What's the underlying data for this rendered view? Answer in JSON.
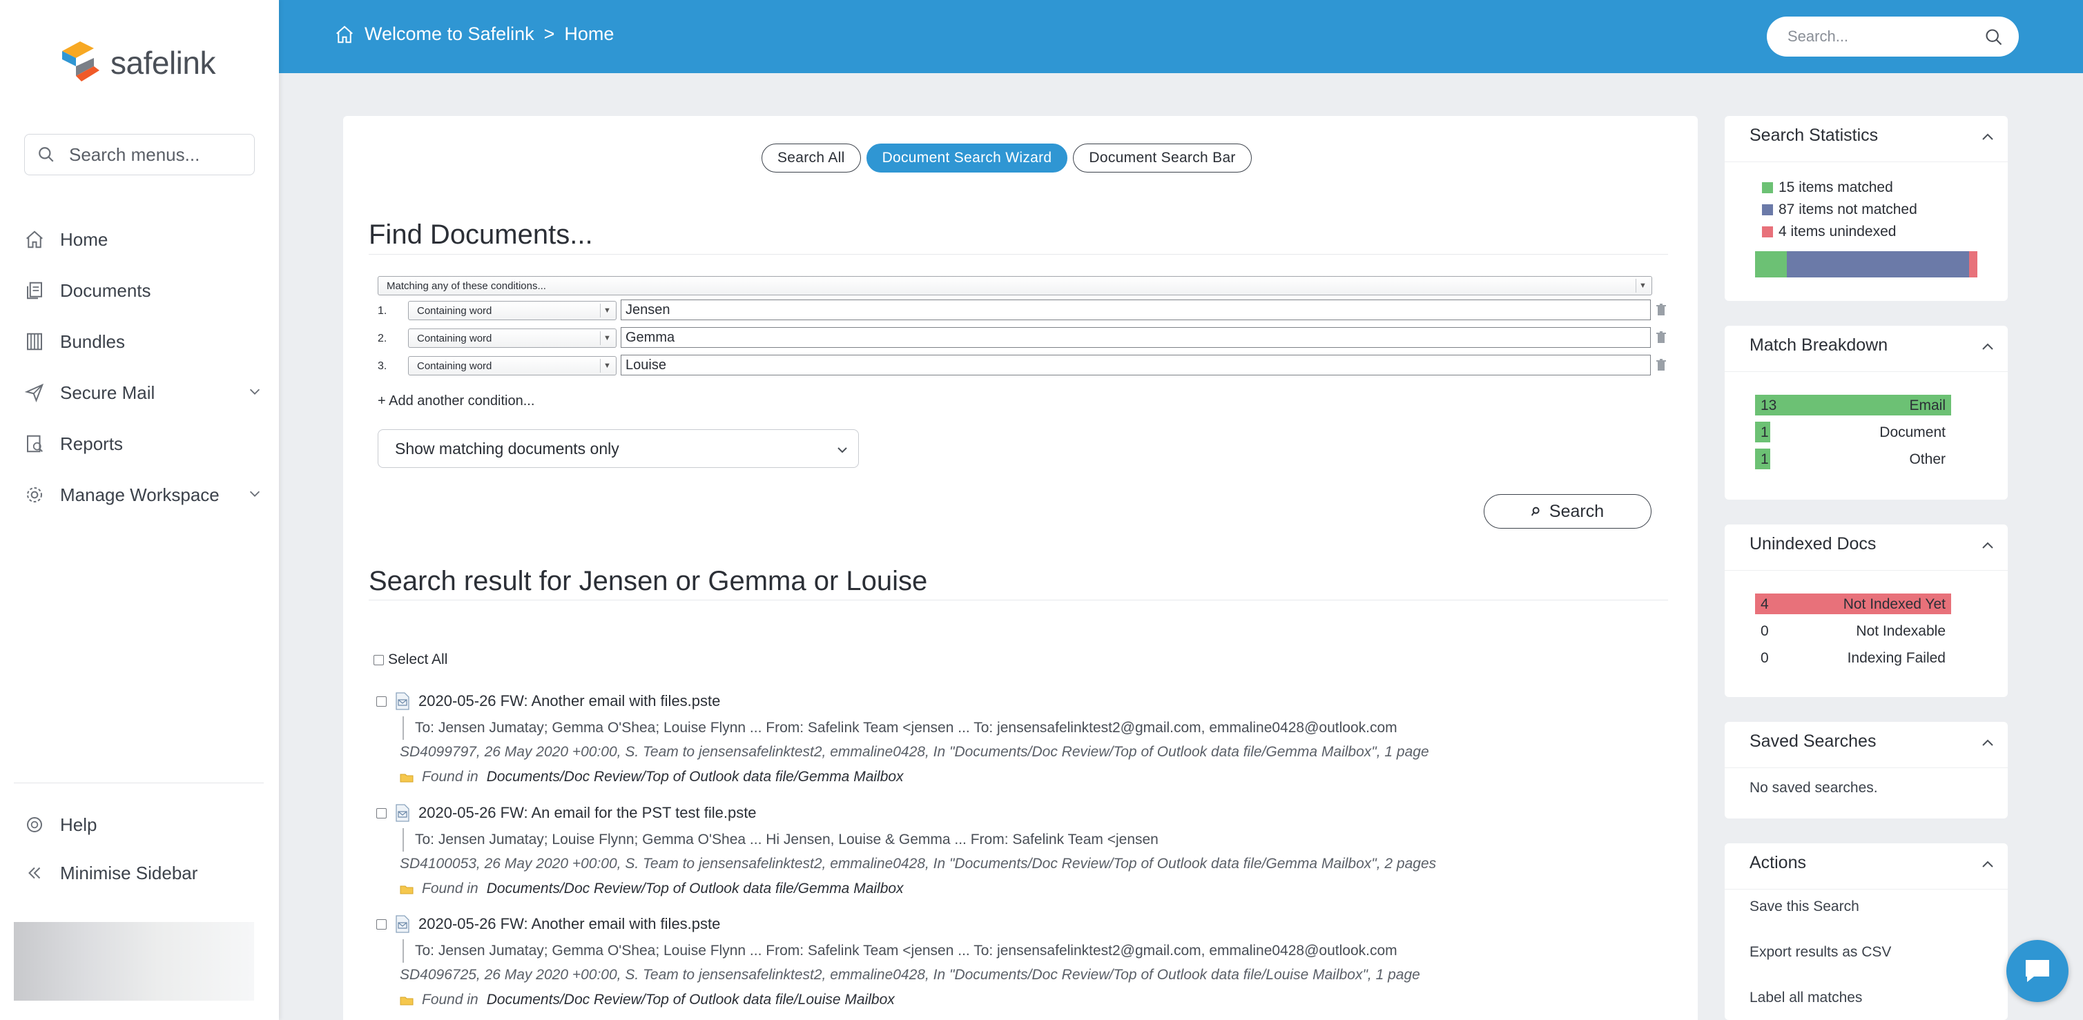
{
  "app": {
    "logo_text": "safelink"
  },
  "sidebar": {
    "search_placeholder": "Search menus...",
    "items": [
      {
        "label": "Home",
        "icon": "home-icon"
      },
      {
        "label": "Documents",
        "icon": "documents-icon"
      },
      {
        "label": "Bundles",
        "icon": "bundles-icon"
      },
      {
        "label": "Secure Mail",
        "icon": "send-icon",
        "expandable": true
      },
      {
        "label": "Reports",
        "icon": "reports-icon"
      },
      {
        "label": "Manage Workspace",
        "icon": "gear-icon",
        "expandable": true
      }
    ],
    "help_label": "Help",
    "minimise_label": "Minimise Sidebar"
  },
  "topbar": {
    "breadcrumb": [
      "Welcome to Safelink",
      ">",
      "Home"
    ],
    "search_placeholder": "Search..."
  },
  "main": {
    "modes": [
      {
        "label": "Search All",
        "active": false
      },
      {
        "label": "Document Search Wizard",
        "active": true
      },
      {
        "label": "Document Search Bar",
        "active": false
      }
    ],
    "find_title": "Find Documents...",
    "match_mode": "Matching any of these conditions...",
    "conditions": [
      {
        "num": "1.",
        "type": "Containing word",
        "value": "Jensen"
      },
      {
        "num": "2.",
        "type": "Containing word",
        "value": "Gemma"
      },
      {
        "num": "3.",
        "type": "Containing word",
        "value": "Louise"
      }
    ],
    "add_condition": "+ Add another condition...",
    "show_option": "Show matching documents only",
    "search_button": "Search",
    "result_title": "Search result for Jensen or Gemma or Louise",
    "select_all": "Select All",
    "results": [
      {
        "title": "2020-05-26 FW: Another email with files.pste",
        "snippet": "To: Jensen Jumatay; Gemma O'Shea; Louise Flynn ... From: Safelink Team <jensen ... To: jensensafelinktest2@gmail.com, emmaline0428@outlook.com",
        "meta": "SD4099797, 26 May 2020 +00:00, S. Team to jensensafelinktest2, emmaline0428, In \"Documents/Doc Review/Top of Outlook data file/Gemma Mailbox\", 1 page",
        "found_prefix": "Found in",
        "found_path": "Documents/Doc Review/Top of Outlook data file/Gemma Mailbox"
      },
      {
        "title": "2020-05-26 FW: An email for the PST test file.pste",
        "snippet": "To: Jensen Jumatay; Louise Flynn; Gemma O'Shea ... Hi Jensen, Louise & Gemma ... From: Safelink Team <jensen",
        "meta": "SD4100053, 26 May 2020 +00:00, S. Team to jensensafelinktest2, emmaline0428, In \"Documents/Doc Review/Top of Outlook data file/Gemma Mailbox\", 2 pages",
        "found_prefix": "Found in",
        "found_path": "Documents/Doc Review/Top of Outlook data file/Gemma Mailbox"
      },
      {
        "title": "2020-05-26 FW: Another email with files.pste",
        "snippet": "To: Jensen Jumatay; Gemma O'Shea; Louise Flynn ... From: Safelink Team <jensen ... To: jensensafelinktest2@gmail.com, emmaline0428@outlook.com",
        "meta": "SD4096725, 26 May 2020 +00:00, S. Team to jensensafelinktest2, emmaline0428, In \"Documents/Doc Review/Top of Outlook data file/Louise Mailbox\", 1 page",
        "found_prefix": "Found in",
        "found_path": "Documents/Doc Review/Top of Outlook data file/Louise Mailbox"
      }
    ]
  },
  "widgets": {
    "stats": {
      "title": "Search Statistics",
      "legend": [
        {
          "label": "15 items matched",
          "color": "#6cc174",
          "count": 15
        },
        {
          "label": "87 items not matched",
          "color": "#6b7aa8",
          "count": 87
        },
        {
          "label": "4 items unindexed",
          "color": "#e8717a",
          "count": 4
        }
      ]
    },
    "breakdown": {
      "title": "Match Breakdown",
      "color": "#6cc174",
      "rows": [
        {
          "n": "13",
          "label": "Email",
          "fraction": 1.0
        },
        {
          "n": "1",
          "label": "Document",
          "fraction": 0.077
        },
        {
          "n": "1",
          "label": "Other",
          "fraction": 0.077
        }
      ]
    },
    "unindexed": {
      "title": "Unindexed Docs",
      "color": "#e8717a",
      "rows": [
        {
          "n": "4",
          "label": "Not Indexed Yet",
          "fraction": 1.0
        },
        {
          "n": "0",
          "label": "Not Indexable",
          "fraction": 0
        },
        {
          "n": "0",
          "label": "Indexing Failed",
          "fraction": 0
        }
      ]
    },
    "saved": {
      "title": "Saved Searches",
      "text": "No saved searches."
    },
    "actions": {
      "title": "Actions",
      "items": [
        "Save this Search",
        "Export results as CSV",
        "Label all matches"
      ]
    }
  },
  "colors": {
    "accent": "#2f96d3"
  }
}
